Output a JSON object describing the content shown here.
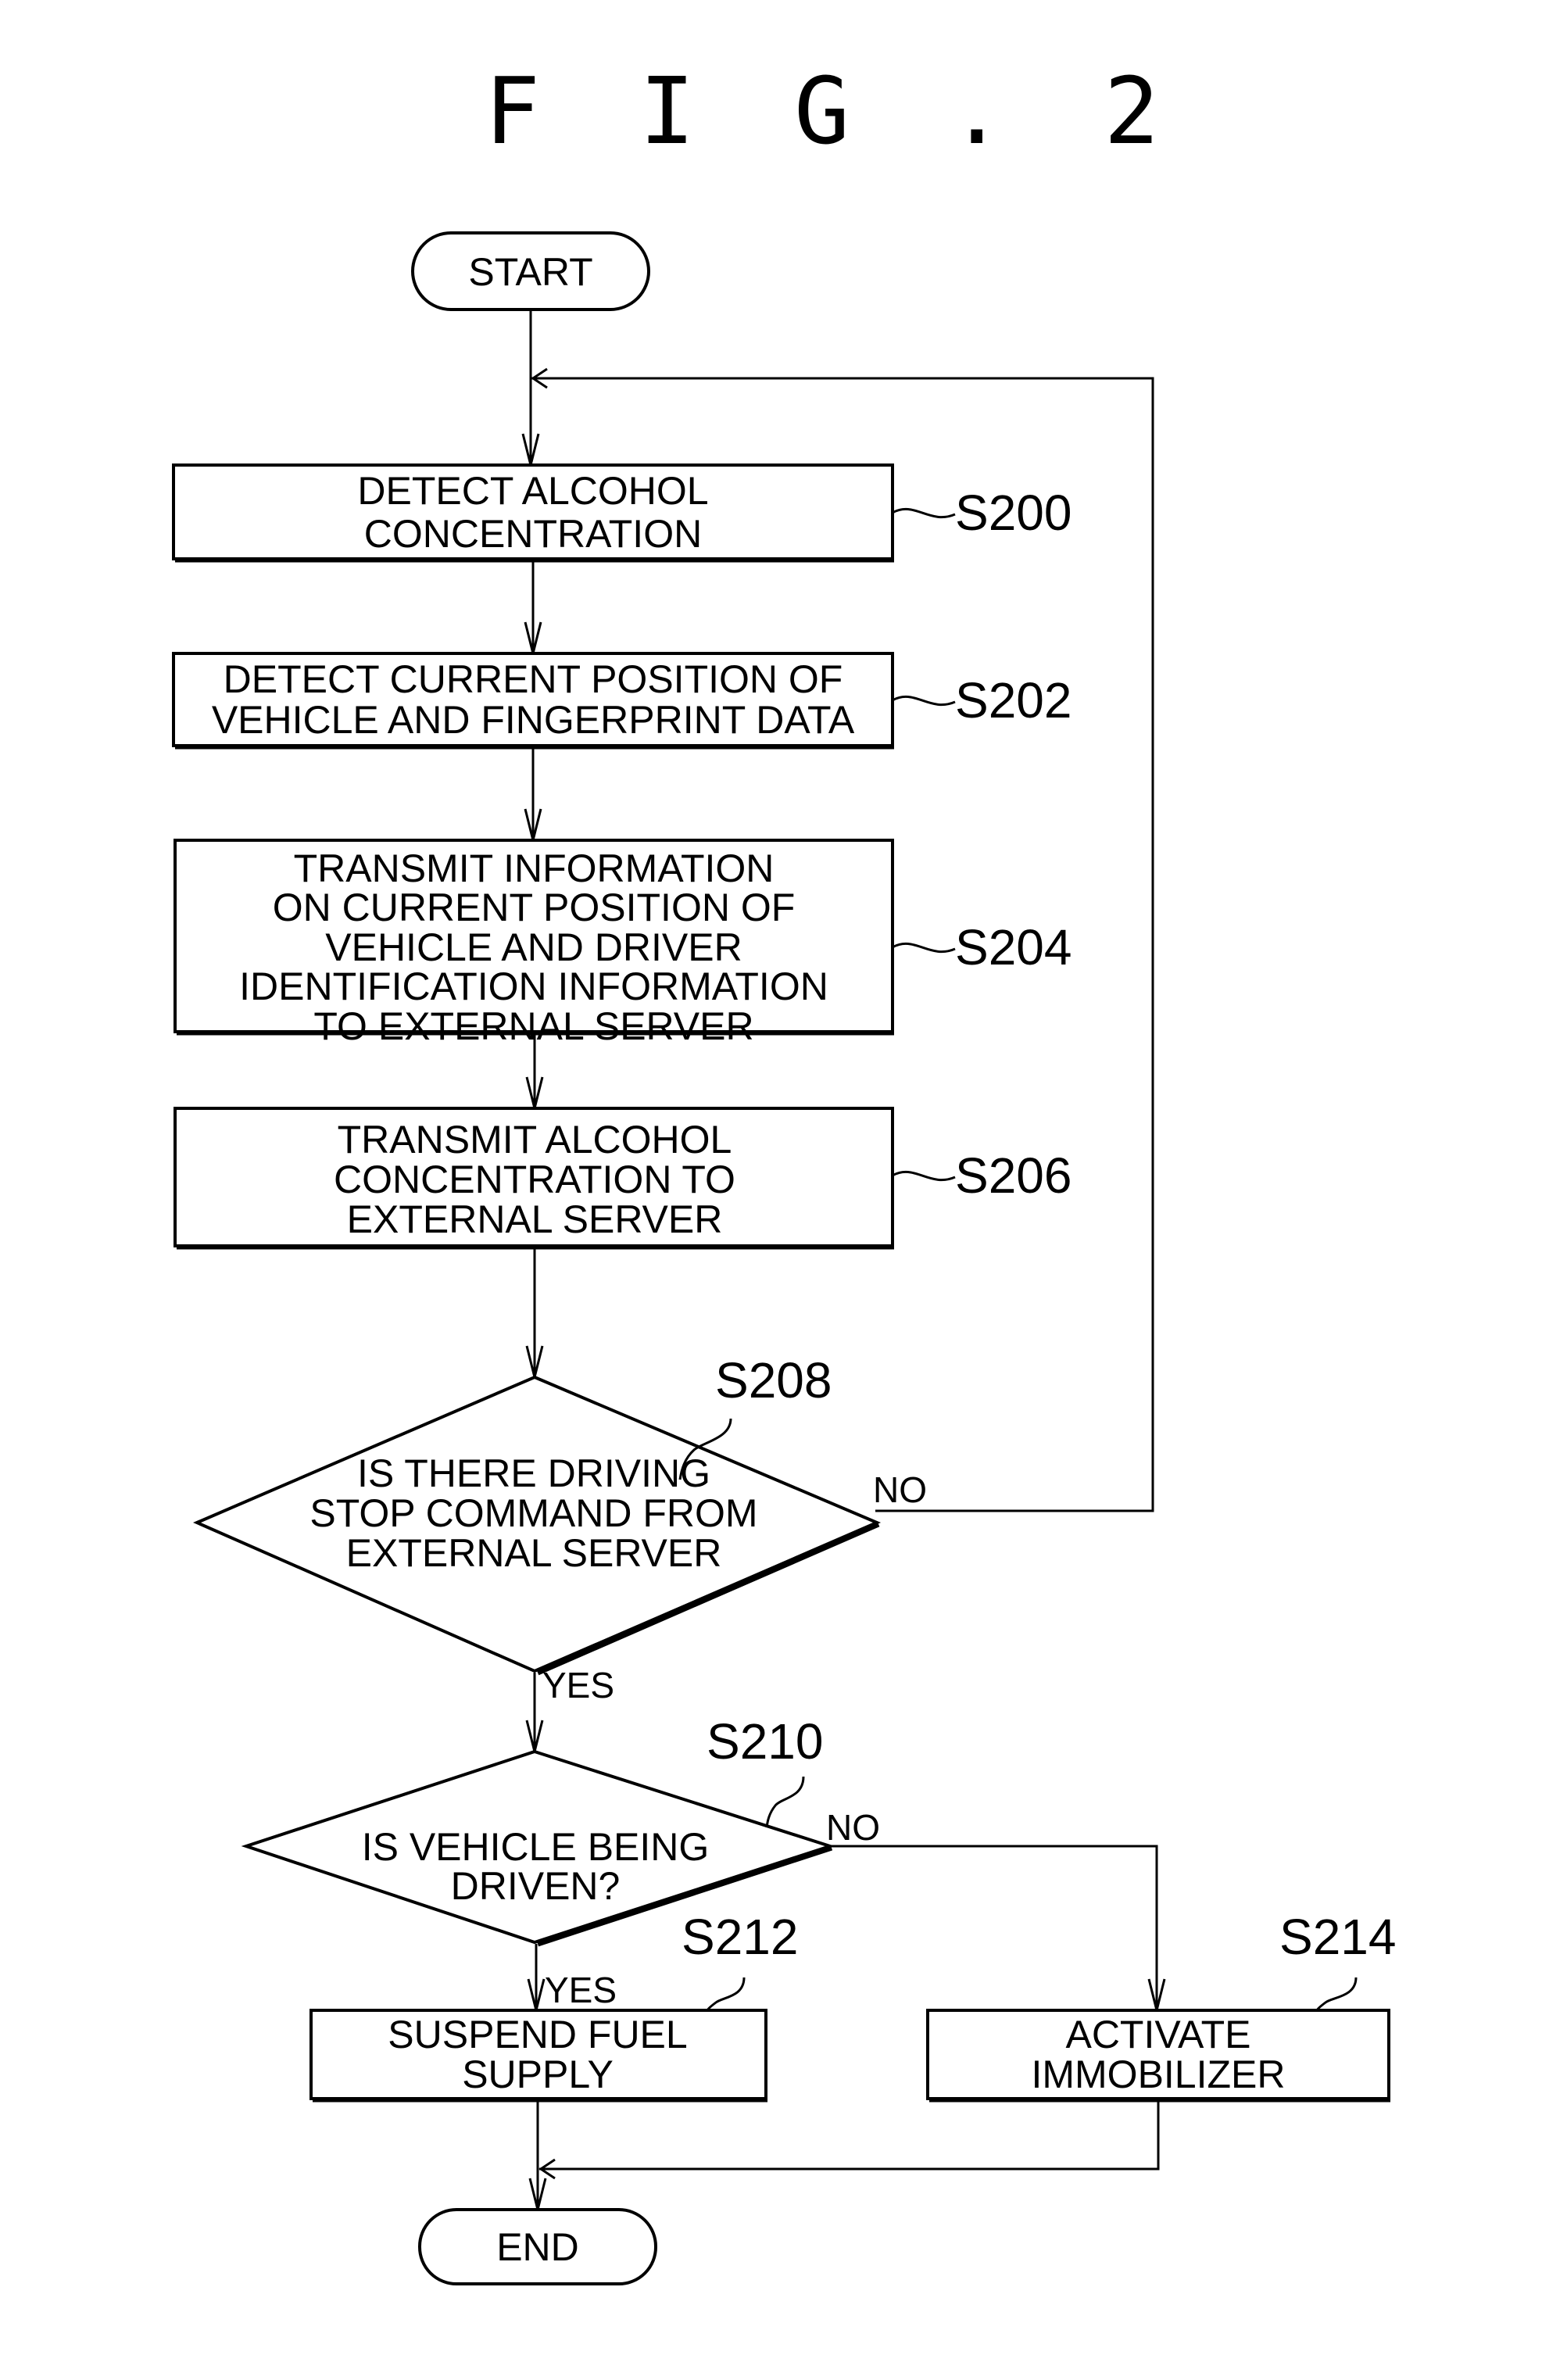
{
  "figure": {
    "title": "F I G . 2"
  },
  "terminals": {
    "start": "START",
    "end": "END"
  },
  "steps": {
    "s200": {
      "id": "S200",
      "lines": [
        "DETECT ALCOHOL",
        "CONCENTRATION"
      ]
    },
    "s202": {
      "id": "S202",
      "lines": [
        "DETECT CURRENT POSITION OF",
        "VEHICLE AND FINGERPRINT DATA"
      ]
    },
    "s204": {
      "id": "S204",
      "lines": [
        "TRANSMIT INFORMATION",
        "ON CURRENT POSITION OF",
        "VEHICLE AND DRIVER",
        "IDENTIFICATION INFORMATION",
        "TO EXTERNAL SERVER"
      ]
    },
    "s206": {
      "id": "S206",
      "lines": [
        "TRANSMIT ALCOHOL",
        "CONCENTRATION TO",
        "EXTERNAL SERVER"
      ]
    },
    "s208": {
      "id": "S208",
      "lines": [
        "IS THERE DRIVING",
        "STOP COMMAND FROM",
        "EXTERNAL SERVER"
      ]
    },
    "s210": {
      "id": "S210",
      "lines": [
        "IS VEHICLE BEING",
        "DRIVEN?"
      ]
    },
    "s212": {
      "id": "S212",
      "lines": [
        "SUSPEND FUEL",
        "SUPPLY"
      ]
    },
    "s214": {
      "id": "S214",
      "lines": [
        "ACTIVATE",
        "IMMOBILIZER"
      ]
    }
  },
  "branches": {
    "s208_yes": "YES",
    "s208_no": "NO",
    "s210_yes": "YES",
    "s210_no": "NO"
  }
}
